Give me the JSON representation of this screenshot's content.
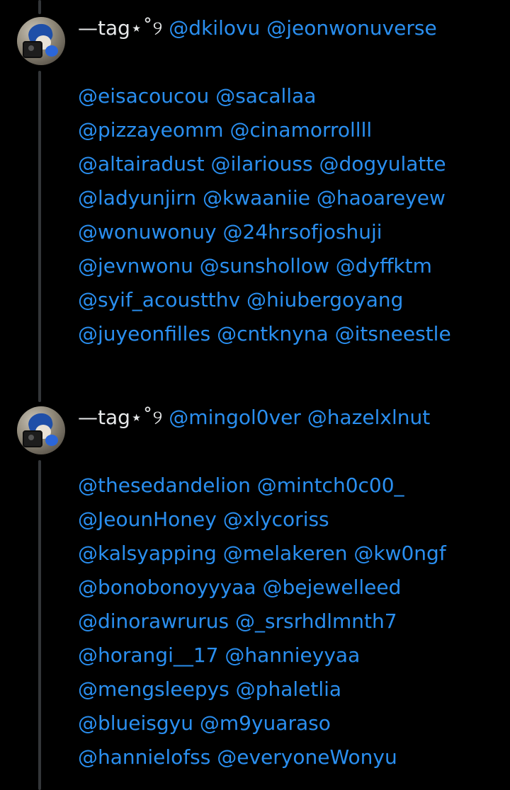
{
  "tweets": [
    {
      "name": "—tag⋆˚୨",
      "first_line_mentions": "@dkilovu  @jeonwonuverse",
      "lines": [
        "@eisacoucou @sacallaa",
        "@pizzayeomm @cinamorrollll",
        "@altairadust @ilariouss @dogyulatte",
        "@ladyunjirn @kwaaniie @haoareyew",
        "@wonuwonuy @24hrsofjoshuji",
        "@jevnwonu @sunshollow @dyffktm",
        "@syif_acoustthv @hiubergoyang",
        "@juyeonfilles @cntknyna @itsneestle"
      ]
    },
    {
      "name": "—tag⋆˚୨",
      "first_line_mentions": "@mingol0ver @hazelxlnut",
      "lines": [
        "@thesedandelion @mintch0c00_",
        "@JeounHoney @xlycoriss",
        "@kalsyapping @melakeren @kw0ngf",
        "@bonobonoyyyaa @bejewelleed",
        "@dinorawrurus @_srsrhdlmnth7",
        "@horangi__17 @hannieyyaa",
        "@mengsleepys @phaletlia",
        "@blueisgyu @m9yuaraso",
        "@hannielofss @everyoneWonyu"
      ]
    }
  ],
  "colors": {
    "background": "#000000",
    "text": "#e7e9ea",
    "mention": "#2a8ff0",
    "thread_line": "#333639"
  }
}
